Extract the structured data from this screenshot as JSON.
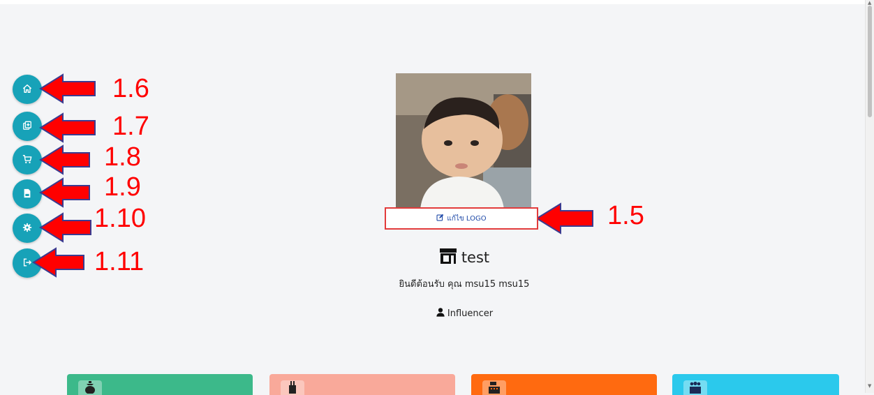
{
  "sidebar": {
    "items": [
      {
        "icon": "home-icon",
        "label": "1.6"
      },
      {
        "icon": "add-copy-icon",
        "label": "1.7"
      },
      {
        "icon": "cart-icon",
        "label": "1.8"
      },
      {
        "icon": "file-icon",
        "label": "1.9"
      },
      {
        "icon": "gear-icon",
        "label": "1.10"
      },
      {
        "icon": "logout-icon",
        "label": "1.11"
      }
    ]
  },
  "profile": {
    "edit_logo_label": "แก้ไข LOGO",
    "edit_logo_annotation": "1.5",
    "shop_name": "test",
    "welcome_text": "ยินดีต้อนรับ คุณ msu15 msu15",
    "role": "Influencer"
  },
  "cards": [
    {
      "color": "#3cb98a",
      "icon": "money-bag-icon"
    },
    {
      "color": "#f9a99a",
      "icon": "bottle-icon"
    },
    {
      "color": "#ff6a10",
      "icon": "cash-register-icon"
    },
    {
      "color": "#2bc9ec",
      "icon": "users-icon"
    }
  ],
  "colors": {
    "sidebar_button": "#17a2b8",
    "annotation": "#ff0000",
    "edit_logo_border": "#e23b3b",
    "link_blue": "#1f4aa8"
  }
}
